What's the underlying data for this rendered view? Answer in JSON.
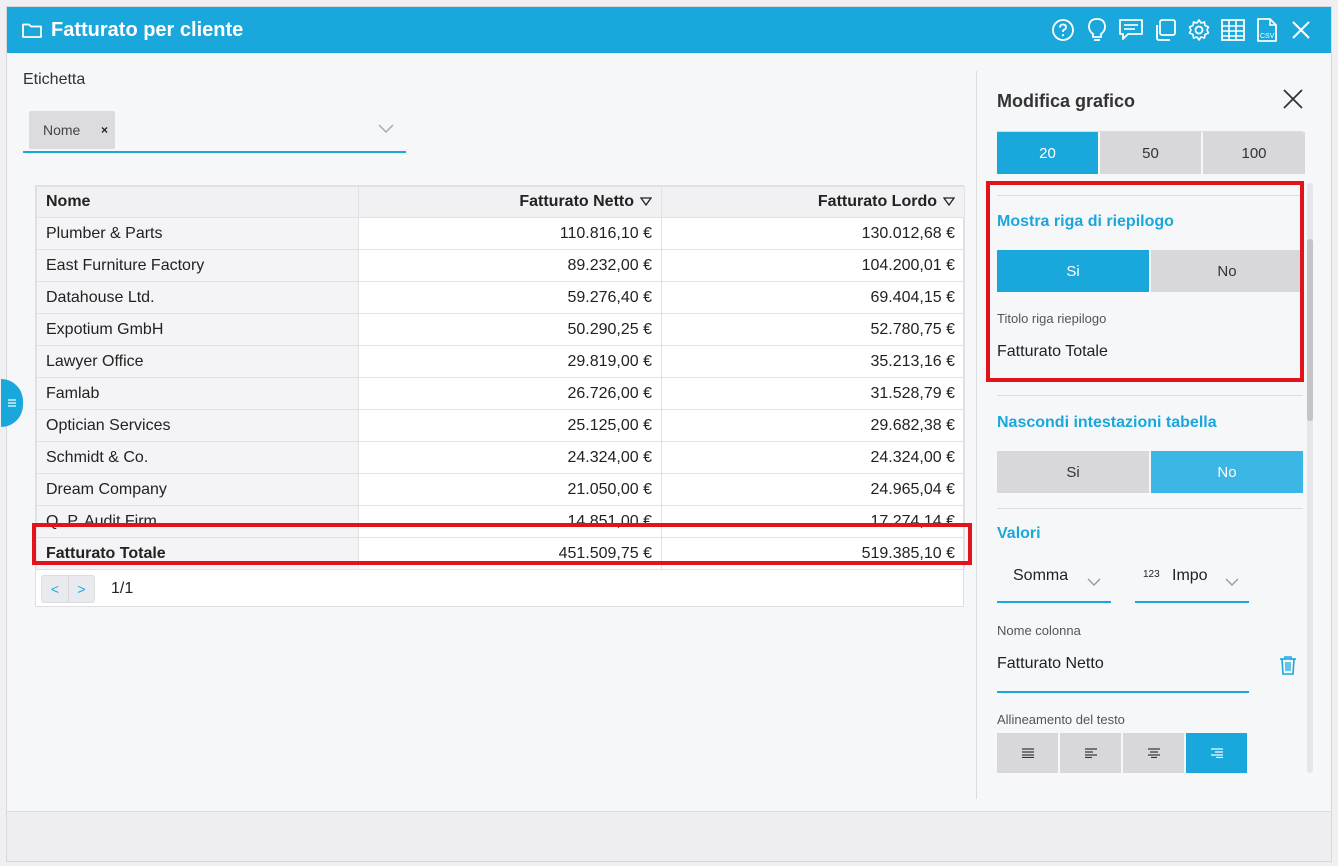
{
  "window": {
    "title": "Fatturato per cliente",
    "tools": [
      "help-icon",
      "lightbulb-icon",
      "comment-icon",
      "copy-icon",
      "gear-icon",
      "table-icon",
      "csv-icon",
      "close-icon"
    ]
  },
  "label_field": {
    "label": "Etichetta",
    "chip": "Nome",
    "chip_remove": "×"
  },
  "table": {
    "headers": {
      "name": "Nome",
      "net": "Fatturato Netto",
      "gross": "Fatturato Lordo"
    },
    "rows": [
      {
        "name": "Plumber & Parts",
        "net": "110.816,10 €",
        "gross": "130.012,68 €"
      },
      {
        "name": "East Furniture Factory",
        "net": "89.232,00 €",
        "gross": "104.200,01 €"
      },
      {
        "name": "Datahouse Ltd.",
        "net": "59.276,40 €",
        "gross": "69.404,15 €"
      },
      {
        "name": "Expotium GmbH",
        "net": "50.290,25 €",
        "gross": "52.780,75 €"
      },
      {
        "name": "Lawyer Office",
        "net": "29.819,00 €",
        "gross": "35.213,16 €"
      },
      {
        "name": "Famlab",
        "net": "26.726,00 €",
        "gross": "31.528,79 €"
      },
      {
        "name": "Optician Services",
        "net": "25.125,00 €",
        "gross": "29.682,38 €"
      },
      {
        "name": "Schmidt & Co.",
        "net": "24.324,00 €",
        "gross": "24.324,00 €"
      },
      {
        "name": "Dream Company",
        "net": "21.050,00 €",
        "gross": "24.965,04 €"
      },
      {
        "name": "Q. P. Audit Firm",
        "net": "14.851,00 €",
        "gross": "17.274,14 €"
      }
    ],
    "total": {
      "name": "Fatturato Totale",
      "net": "451.509,75 €",
      "gross": "519.385,10 €"
    },
    "pager": {
      "prev": "<",
      "next": ">",
      "info": "1/1"
    }
  },
  "panel": {
    "title": "Modifica grafico",
    "page_sizes": [
      "20",
      "50",
      "100"
    ],
    "summary_row": {
      "title": "Mostra riga di riepilogo",
      "yes": "Si",
      "no": "No",
      "field_label": "Titolo riga riepilogo",
      "field_value": "Fatturato Totale"
    },
    "hide_headers": {
      "title": "Nascondi intestazioni tabella",
      "yes": "Si",
      "no": "No"
    },
    "values": {
      "title": "Valori",
      "aggregation": "Somma",
      "format_prefix": "123",
      "format": "Impo",
      "column_name_label": "Nome colonna",
      "column_name": "Fatturato Netto",
      "alignment_label": "Allineamento del testo"
    }
  },
  "colors": {
    "accent": "#1aa7dc",
    "highlight": "#e0141a"
  }
}
